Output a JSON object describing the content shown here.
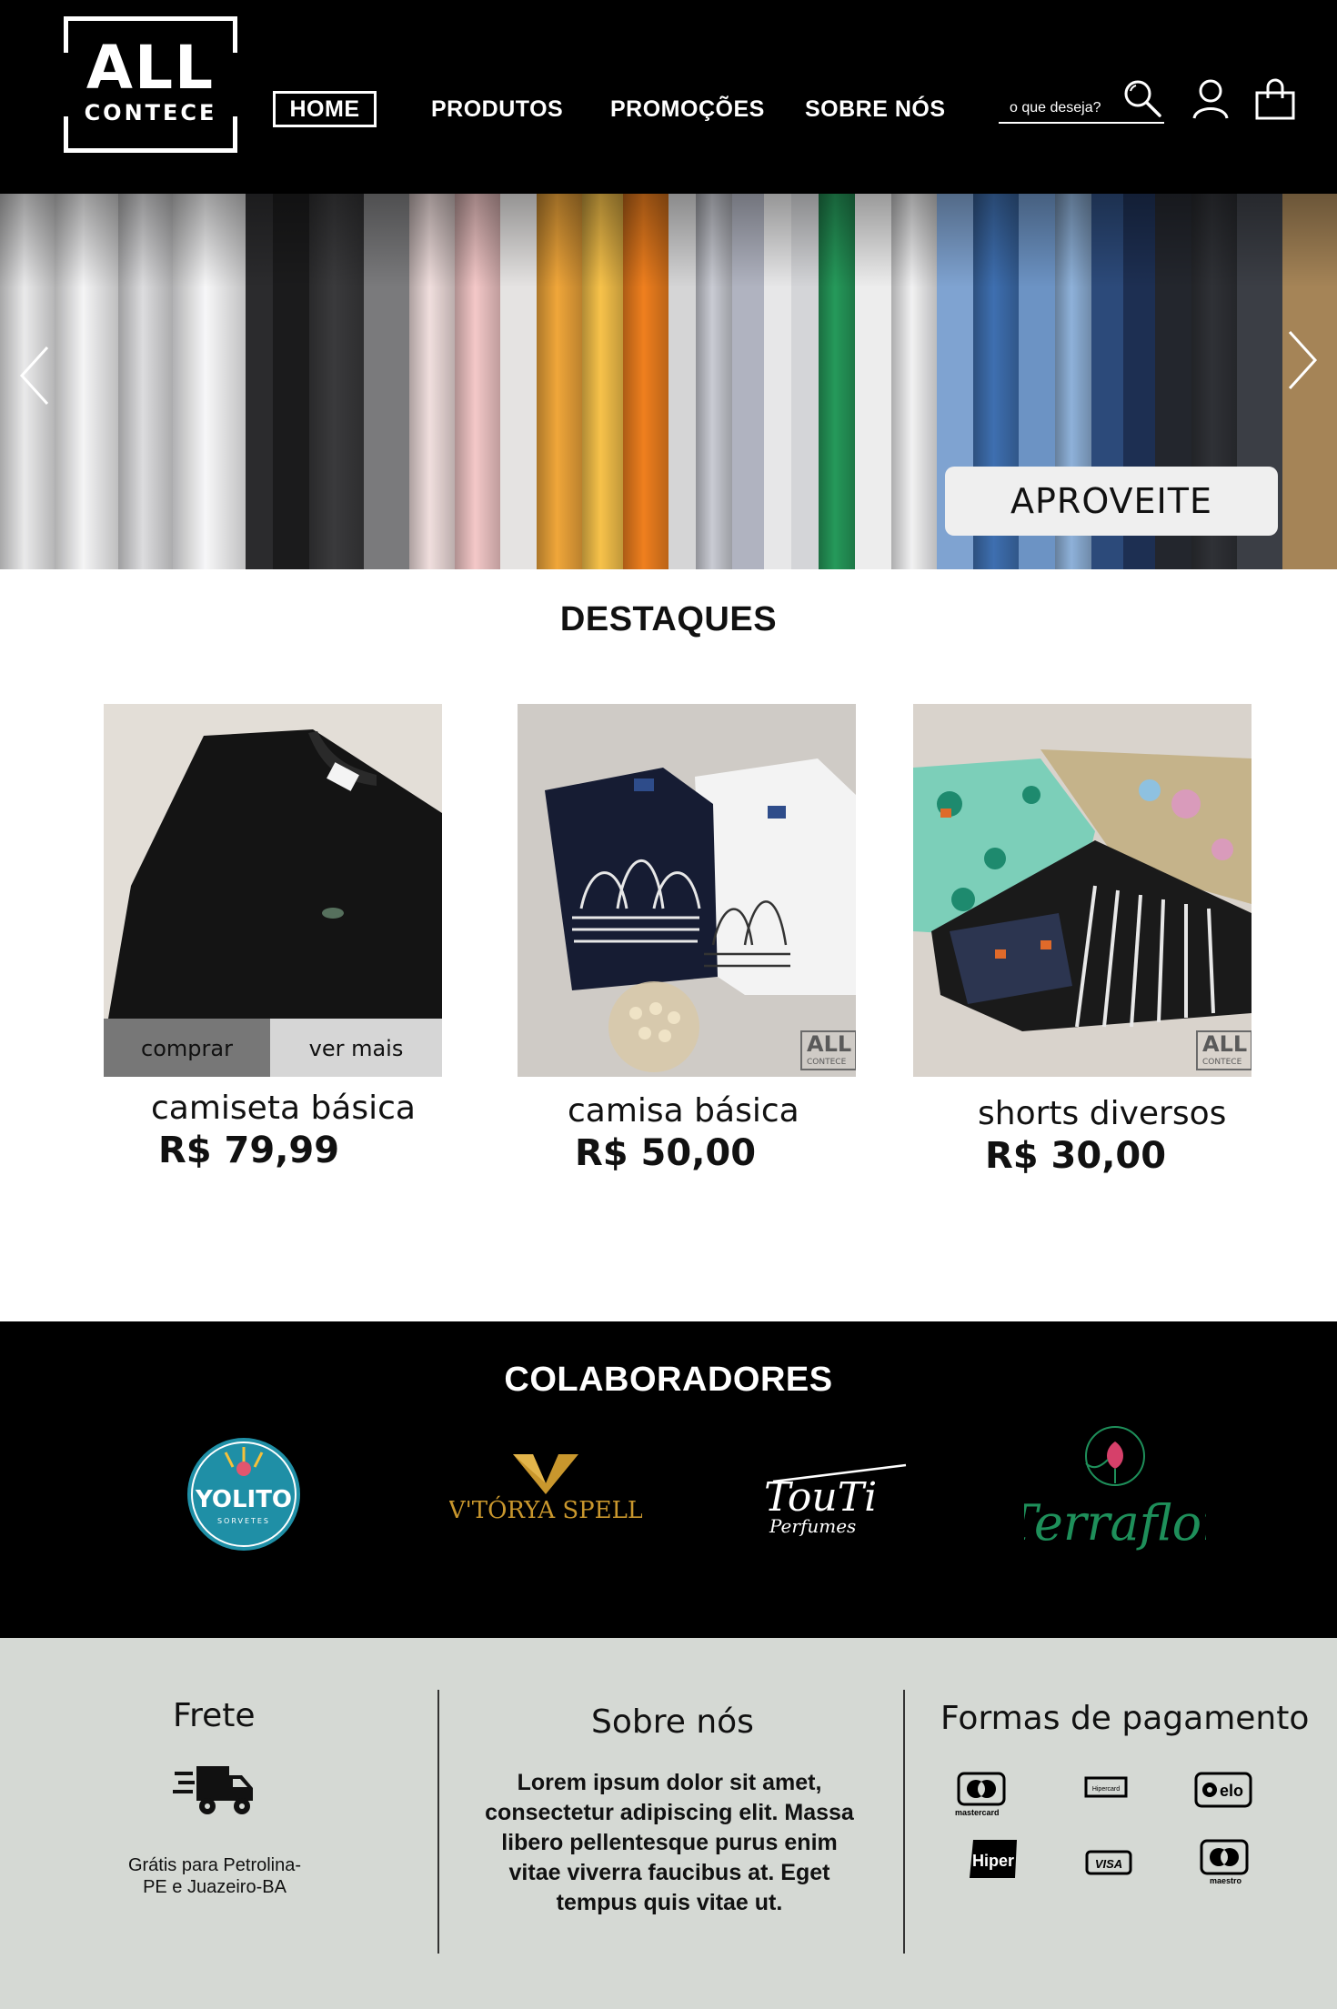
{
  "header": {
    "logo": {
      "line1": "ALL",
      "line2": "CONTECE"
    },
    "nav": [
      {
        "label": "HOME",
        "active": true
      },
      {
        "label": "PRODUTOS"
      },
      {
        "label": "PROMOÇÕES"
      },
      {
        "label": "SOBRE NÓS"
      }
    ],
    "search": {
      "placeholder": "o que deseja?",
      "icon": "search-icon"
    },
    "icons": [
      "user-icon",
      "shopping-bag-icon"
    ]
  },
  "hero": {
    "cta_label": "APROVEITE",
    "prev_icon": "chevron-left-icon",
    "next_icon": "chevron-right-icon"
  },
  "destaques": {
    "title": "DESTAQUES",
    "products": [
      {
        "name": "camiseta básica",
        "price": "R$ 79,99",
        "buy_label": "comprar",
        "more_label": "ver mais"
      },
      {
        "name": "camisa básica",
        "price": "R$ 50,00"
      },
      {
        "name": "shorts diversos",
        "price": "R$ 30,00"
      }
    ]
  },
  "colaboradores": {
    "title": "COLABORADORES",
    "partners": [
      {
        "name": "YOLITO",
        "sub": "SORVETES"
      },
      {
        "name": "V'TÓRYA SPELL"
      },
      {
        "name": "TouTi",
        "sub": "Perfumes"
      },
      {
        "name": "Terraflor"
      }
    ]
  },
  "footer": {
    "frete": {
      "title": "Frete",
      "icon": "delivery-truck-icon",
      "text": "Grátis para Petrolina-PE e Juazeiro-BA"
    },
    "sobre": {
      "title": "Sobre nós",
      "text": "Lorem ipsum dolor sit amet, consectetur adipiscing elit. Massa libero pellentesque purus enim vitae viverra faucibus at. Eget tempus quis vitae ut."
    },
    "pagamento": {
      "title": "Formas de pagamento",
      "methods": [
        "mastercard",
        "Hipercard",
        "elo",
        "Hiper",
        "VISA",
        "maestro"
      ]
    }
  }
}
